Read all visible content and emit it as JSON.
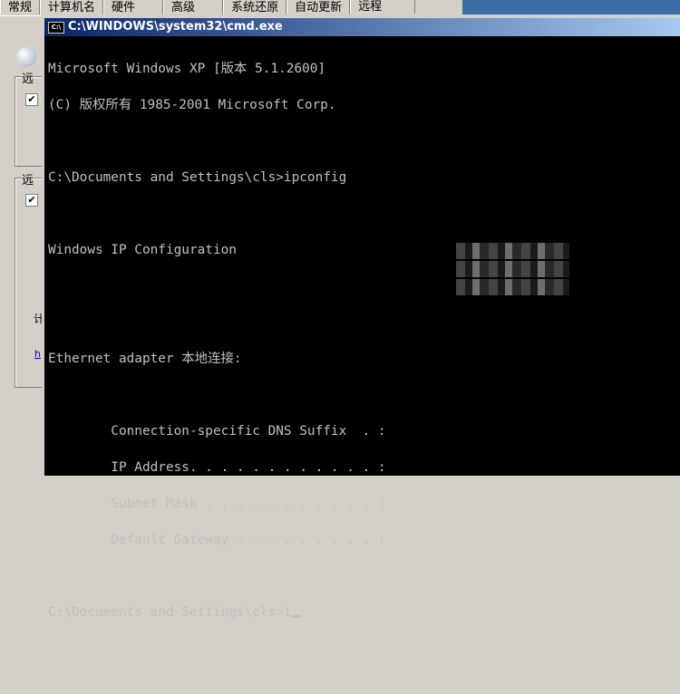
{
  "dialog": {
    "tabs": [
      "常规",
      "计算机名",
      "硬件",
      "高级",
      "系统还原",
      "自动更新",
      "远程"
    ],
    "active_tab": "远程",
    "groups": [
      {
        "label": "远",
        "checked": true
      },
      {
        "label": "远",
        "checked": true
      }
    ],
    "text_fragment": "计",
    "link_fragment": "h"
  },
  "cmd": {
    "title": "C:\\WINDOWS\\system32\\cmd.exe",
    "icon_label": "C:\\",
    "lines": [
      "Microsoft Windows XP [版本 5.1.2600]",
      "(C) 版权所有 1985-2001 Microsoft Corp.",
      "",
      "C:\\Documents and Settings\\cls>ipconfig",
      "",
      "Windows IP Configuration",
      "",
      "",
      "Ethernet adapter 本地连接:",
      "",
      "        Connection-specific DNS Suffix  . :",
      "        IP Address. . . . . . . . . . . . :",
      "        Subnet Mask . . . . . . . . . . . :",
      "        Default Gateway . . . . . . . . . :",
      "",
      "C:\\Documents and Settings\\cls>i"
    ]
  }
}
